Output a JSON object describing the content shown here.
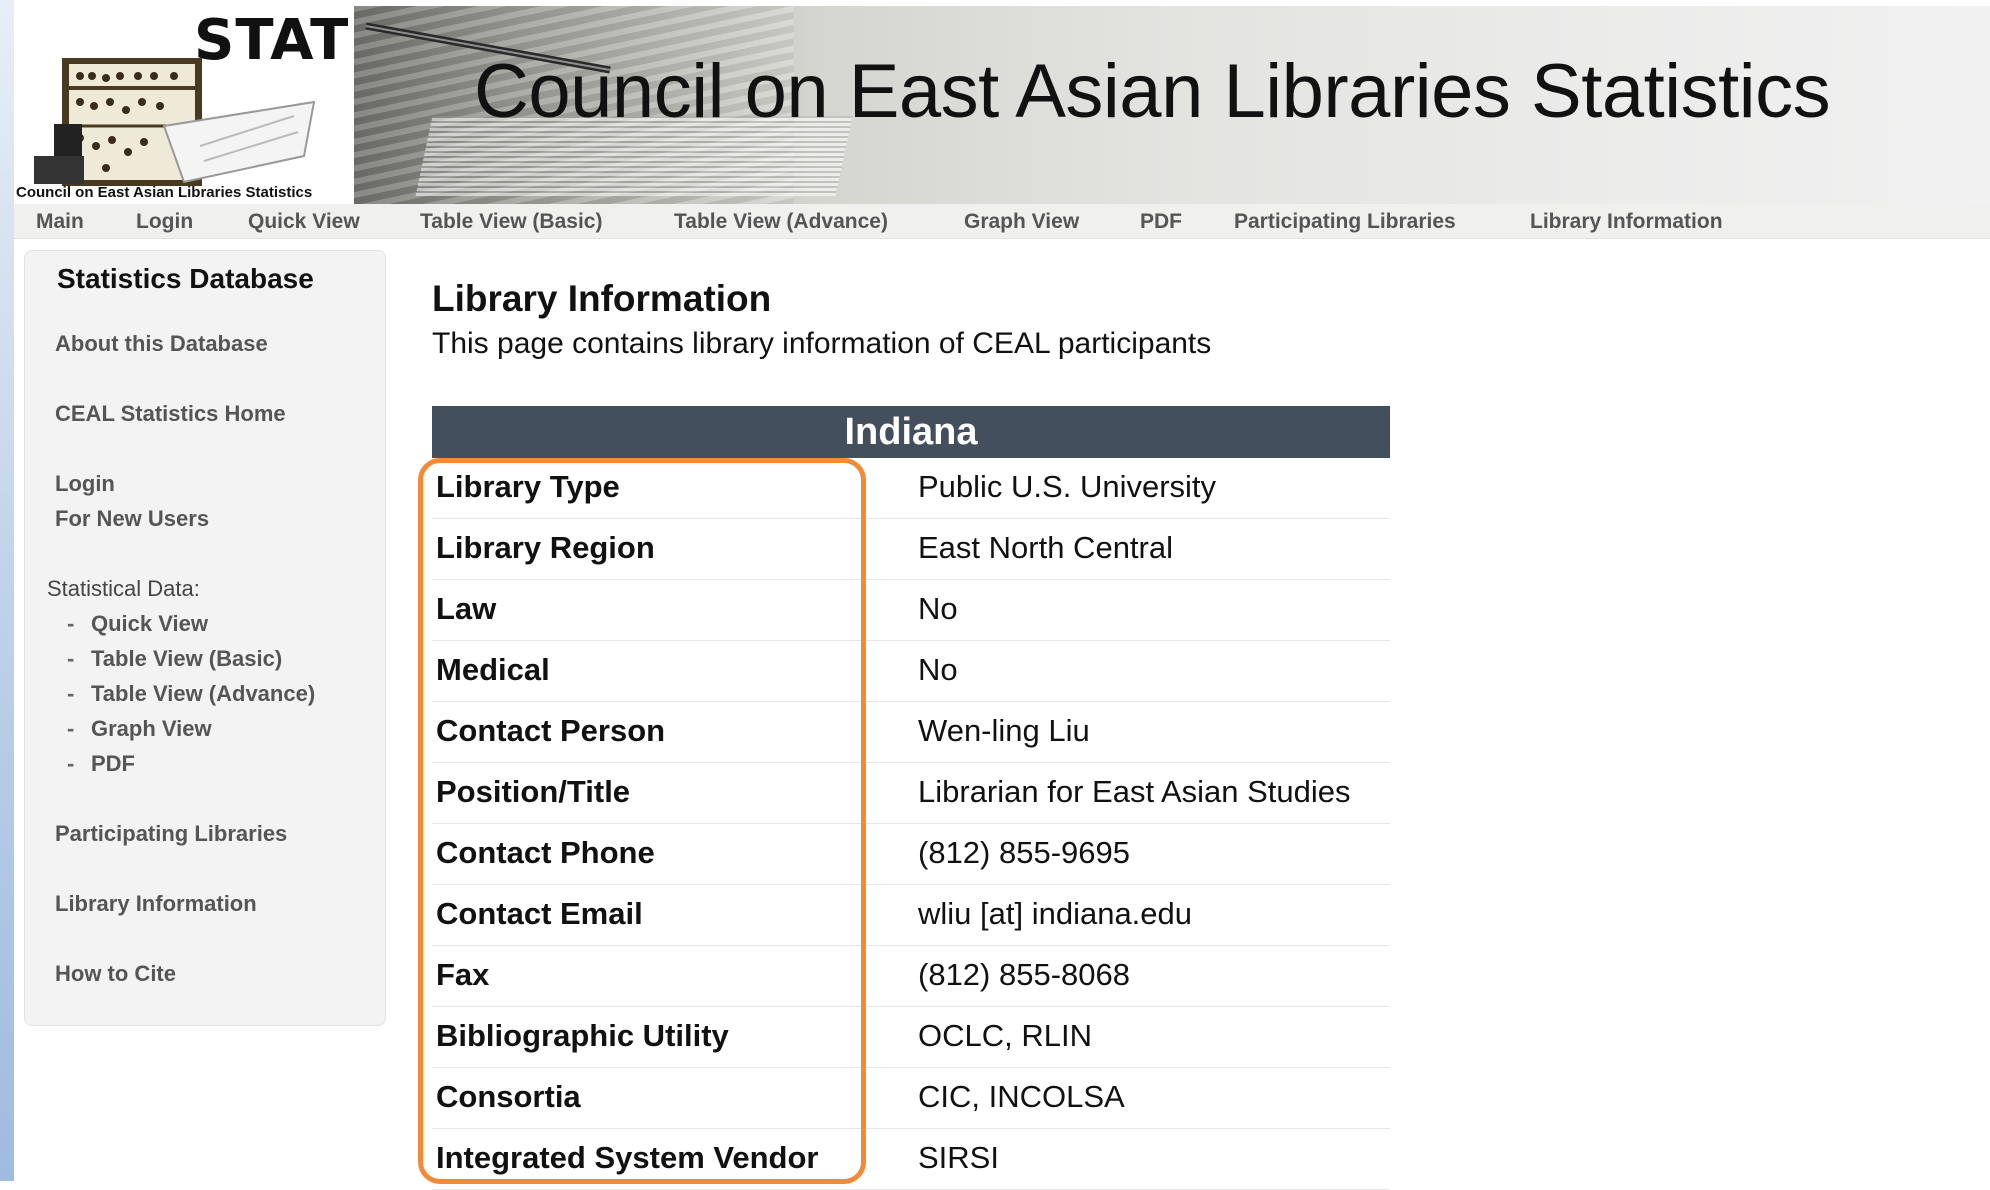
{
  "header": {
    "logo_text": "STAT",
    "logo_caption": "Council on East Asian Libraries Statistics",
    "title": "Council on East Asian Libraries Statistics"
  },
  "nav": [
    "Main",
    "Login",
    "Quick View",
    "Table View (Basic)",
    "Table View (Advance)",
    "Graph View",
    "PDF",
    "Participating Libraries",
    "Library Information"
  ],
  "sidebar": {
    "heading": "Statistics Database",
    "about": "About this Database",
    "home": "CEAL Statistics Home",
    "login": "Login",
    "new_users": "For New Users",
    "stat_label": "Statistical Data:",
    "stat_items": [
      "Quick View",
      "Table View (Basic)",
      "Table View (Advance)",
      "Graph View",
      "PDF"
    ],
    "stat_bullet": "-",
    "participating": "Participating Libraries",
    "library_info": "Library Information",
    "how_to_cite": "How to Cite"
  },
  "main": {
    "title": "Library Information",
    "description": "This page contains library information of CEAL participants",
    "library_name": "Indiana",
    "rows": [
      {
        "label": "Library Type",
        "value": "Public U.S. University"
      },
      {
        "label": "Library Region",
        "value": "East North Central"
      },
      {
        "label": "Law",
        "value": "No"
      },
      {
        "label": "Medical",
        "value": "No"
      },
      {
        "label": "Contact Person",
        "value": "Wen-ling Liu"
      },
      {
        "label": "Position/Title",
        "value": "Librarian for East Asian Studies"
      },
      {
        "label": "Contact Phone",
        "value": "(812) 855-9695"
      },
      {
        "label": "Contact Email",
        "value": "wliu [at] indiana.edu"
      },
      {
        "label": "Fax",
        "value": "(812) 855-8068"
      },
      {
        "label": "Bibliographic Utility",
        "value": "OCLC, RLIN"
      },
      {
        "label": "Consortia",
        "value": "CIC, INCOLSA"
      },
      {
        "label": "Integrated System Vendor",
        "value": "SIRSI"
      }
    ]
  },
  "colors": {
    "table_header_bg": "#444f5d",
    "highlight": "#f28a37",
    "nav_text": "#555555"
  }
}
